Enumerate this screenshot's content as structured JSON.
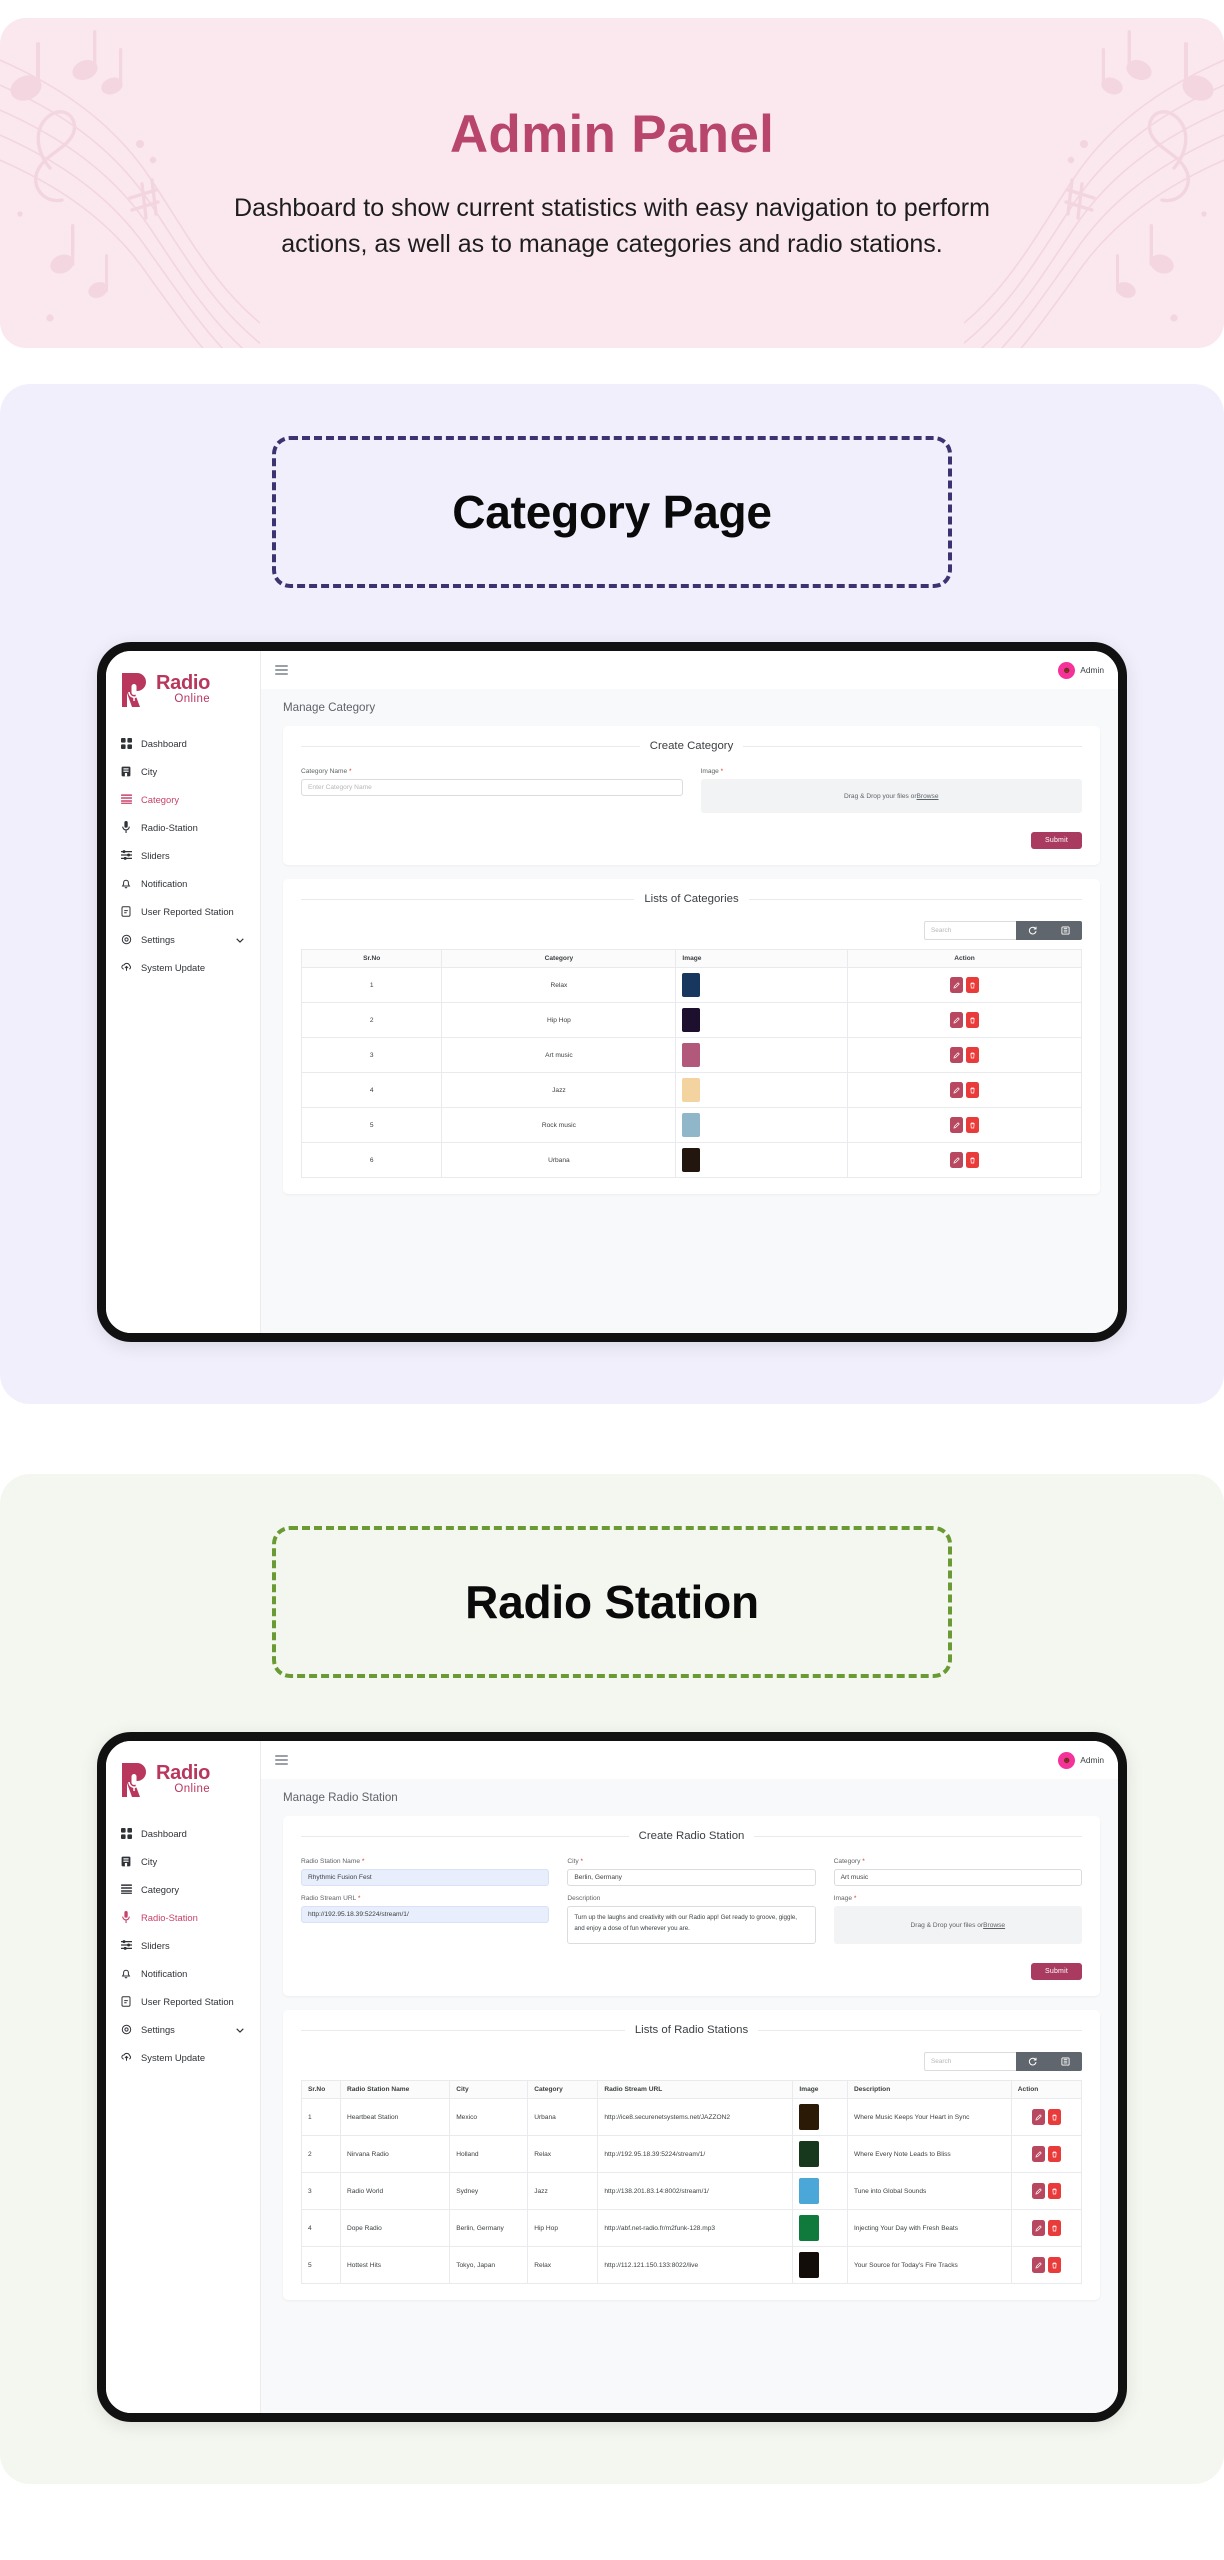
{
  "hero": {
    "title": "Admin Panel",
    "subtitle": "Dashboard to show current statistics with easy navigation to perform actions, as well as to manage categories and radio stations.",
    "title_color": "#b8456c",
    "background": "#fae8ee"
  },
  "sections": [
    {
      "badge_label": "Category Page",
      "badge_border_color": "#3b3470",
      "background": "#f1effb"
    },
    {
      "badge_label": "Radio Station",
      "badge_border_color": "#6a9a33",
      "background": "#f4f7f0"
    }
  ],
  "brand": {
    "name": "Radio",
    "tagline": "Online",
    "color": "#b9365d"
  },
  "topbar": {
    "menu_icon": "hamburger-icon",
    "user_label": "Admin",
    "avatar_icon": "user-avatar-icon"
  },
  "sidebar": {
    "items": [
      {
        "label": "Dashboard",
        "icon": "dashboard-grid-icon"
      },
      {
        "label": "City",
        "icon": "building-icon"
      },
      {
        "label": "Category",
        "icon": "list-lines-icon"
      },
      {
        "label": "Radio-Station",
        "icon": "microphone-icon"
      },
      {
        "label": "Sliders",
        "icon": "sliders-icon"
      },
      {
        "label": "Notification",
        "icon": "bell-icon"
      },
      {
        "label": "User Reported Station",
        "icon": "report-file-icon"
      },
      {
        "label": "Settings",
        "icon": "gear-icon",
        "caret": "chevron-down-icon"
      },
      {
        "label": "System Update",
        "icon": "cloud-upload-icon"
      }
    ],
    "active_category": "Category",
    "active_station": "Radio-Station",
    "active_color": "#c6436a"
  },
  "category_page": {
    "page_title": "Manage Category",
    "form": {
      "heading": "Create Category",
      "name_label": "Category Name",
      "name_placeholder": "Enter Category Name",
      "image_label": "Image",
      "dropzone_text": "Drag & Drop your files or ",
      "dropzone_link": "Browse",
      "submit_label": "Submit"
    },
    "list": {
      "heading": "Lists of Categories",
      "search_placeholder": "Search",
      "refresh_icon": "refresh-icon",
      "columns_icon": "columns-icon",
      "headers": [
        "Sr.No",
        "Category",
        "Image",
        "Action"
      ],
      "rows": [
        {
          "sr": "1",
          "category": "Relax",
          "thumb": "#18375f"
        },
        {
          "sr": "2",
          "category": "Hip Hop",
          "thumb": "#1d0f2e"
        },
        {
          "sr": "3",
          "category": "Art music",
          "thumb": "#b2587a"
        },
        {
          "sr": "4",
          "category": "Jazz",
          "thumb": "#f3d3a0"
        },
        {
          "sr": "5",
          "category": "Rock music",
          "thumb": "#8fb6c9"
        },
        {
          "sr": "6",
          "category": "Urbana",
          "thumb": "#23160f"
        }
      ],
      "edit_icon": "edit-pencil-icon",
      "delete_icon": "trash-icon"
    }
  },
  "station_page": {
    "page_title": "Manage Radio Station",
    "form": {
      "heading": "Create Radio Station",
      "name_label": "Radio Station Name",
      "name_value": "Rhythmic Fusion Fest",
      "city_label": "City",
      "city_value": "Berlin, Germany",
      "category_label": "Category",
      "category_value": "Art music",
      "url_label": "Radio Stream URL",
      "url_value": "http://192.95.18.39:5224/stream/1/",
      "description_label": "Description",
      "description_value": "Turn up the laughs and creativity with our Radio app! Get ready to groove, giggle, and enjoy a dose of fun wherever you are.",
      "image_label": "Image",
      "dropzone_text": "Drag & Drop your files or ",
      "dropzone_link": "Browse",
      "submit_label": "Submit"
    },
    "list": {
      "heading": "Lists of Radio Stations",
      "search_placeholder": "Search",
      "refresh_icon": "refresh-icon",
      "columns_icon": "columns-icon",
      "headers": [
        "Sr.No",
        "Radio Station Name",
        "City",
        "Category",
        "Radio Stream URL",
        "Image",
        "Description",
        "Action"
      ],
      "rows": [
        {
          "sr": "1",
          "name": "Heartbeat Station",
          "city": "Mexico",
          "category": "Urbana",
          "url": "http://ice8.securenetsystems.net/JAZZON2",
          "thumb": "#2b1a06",
          "description": "Where Music Keeps Your Heart in Sync"
        },
        {
          "sr": "2",
          "name": "Nirvana Radio",
          "city": "Holland",
          "category": "Relax",
          "url": "http://192.95.18.39:5224/stream/1/",
          "thumb": "#17381c",
          "description": "Where Every Note Leads to Bliss"
        },
        {
          "sr": "3",
          "name": "Radio World",
          "city": "Sydney",
          "category": "Jazz",
          "url": "http://138.201.83.14:8002/stream/1/",
          "thumb": "#4aa7d8",
          "description": "Tune into Global Sounds"
        },
        {
          "sr": "4",
          "name": "Dope Radio",
          "city": "Berlin, Germany",
          "category": "Hip Hop",
          "url": "http://abf.net-radio.fr/m2funk-128.mp3",
          "thumb": "#0f7a3c",
          "description": "Injecting Your Day with Fresh Beats"
        },
        {
          "sr": "5",
          "name": "Hottest Hits",
          "city": "Tokyo, Japan",
          "category": "Relax",
          "url": "http://112.121.150.133:8022/live",
          "thumb": "#120d08",
          "description": "Your Source for Today's Fire Tracks"
        }
      ],
      "edit_icon": "edit-pencil-icon",
      "delete_icon": "trash-icon"
    }
  },
  "colors": {
    "accent": "#a83b5f",
    "danger": "#ea3b3b",
    "toolbar": "#5f666e"
  }
}
